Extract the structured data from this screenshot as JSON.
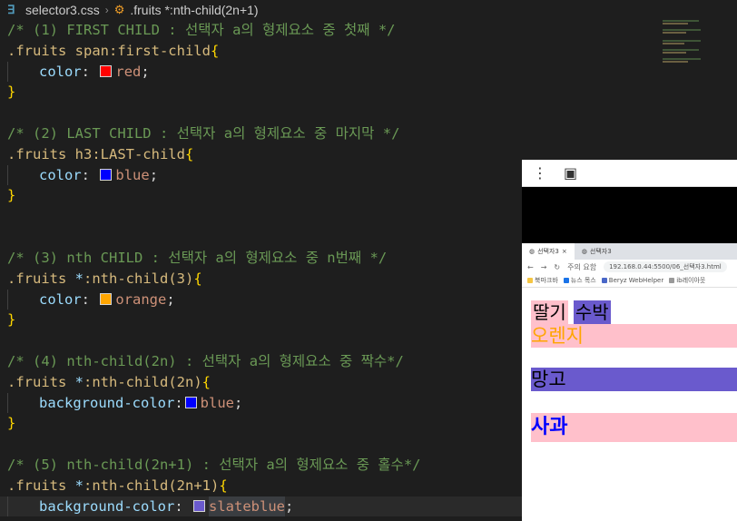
{
  "breadcrumb": {
    "file": "selector3.css",
    "symbol": ".fruits *:nth-child(2n+1)"
  },
  "code": {
    "l1_comment": "/* (1) FIRST CHILD : 선택자 a의 형제요소 중 첫째 */",
    "l2_selector": ".fruits span:first-child",
    "l2_brace": "{",
    "l3_prop": "color",
    "l3_colon": ":",
    "l3_value": "red",
    "l3_semi": ";",
    "l4_brace": "}",
    "l6_comment": "/* (2) LAST CHILD : 선택자 a의 형제요소 중 마지막 */",
    "l7_selector": ".fruits h3:LAST-child",
    "l7_brace": "{",
    "l8_prop": "color",
    "l8_colon": ":",
    "l8_value": "blue",
    "l8_semi": ";",
    "l9_brace": "}",
    "l12_comment": "/* (3) nth CHILD : 선택자 a의 형제요소 중 n번째 */",
    "l13_selector_a": ".fruits ",
    "l13_selector_b": "*",
    "l13_selector_c": ":nth-child(3)",
    "l13_brace": "{",
    "l14_prop": "color",
    "l14_colon": ":",
    "l14_value": "orange",
    "l14_semi": ";",
    "l15_brace": "}",
    "l17_comment": "/* (4) nth-child(2n) : 선택자 a의 형제요소 중 짝수*/",
    "l18_selector_a": ".fruits ",
    "l18_selector_b": "*",
    "l18_selector_c": ":nth-child(2n)",
    "l18_brace": "{",
    "l19_prop": "background-color",
    "l19_colon": ":",
    "l19_value": "blue",
    "l19_semi": ";",
    "l20_brace": "}",
    "l22_comment": "/* (5) nth-child(2n+1) : 선택자 a의 형제요소 중 홀수*/",
    "l23_selector_a": ".fruits ",
    "l23_selector_b": "*",
    "l23_selector_c": ":nth-child(2n+1)",
    "l23_brace": "{",
    "l24_prop": "background-color",
    "l24_colon": ":",
    "l24_value": "slateblue",
    "l24_semi": ";"
  },
  "colors": {
    "red": "#ff0000",
    "blue": "#0000ff",
    "orange": "#ffa500",
    "slateblue": "#6a5acd",
    "pink": "#ffc0cb"
  },
  "browser": {
    "tab1": "선택자3",
    "tab2": "선택자3",
    "security": "주의 요함",
    "url": "192.168.0.44:5500/06_선택자3.html",
    "bookmarks": [
      "북마크바",
      "뉴스 목스",
      "Beryz WebHelper",
      "ib레이아웃"
    ],
    "fruits": {
      "strawberry": "딸기",
      "watermelon": "수박",
      "orange": "오렌지",
      "mango": "망고",
      "apple": "사과"
    }
  }
}
